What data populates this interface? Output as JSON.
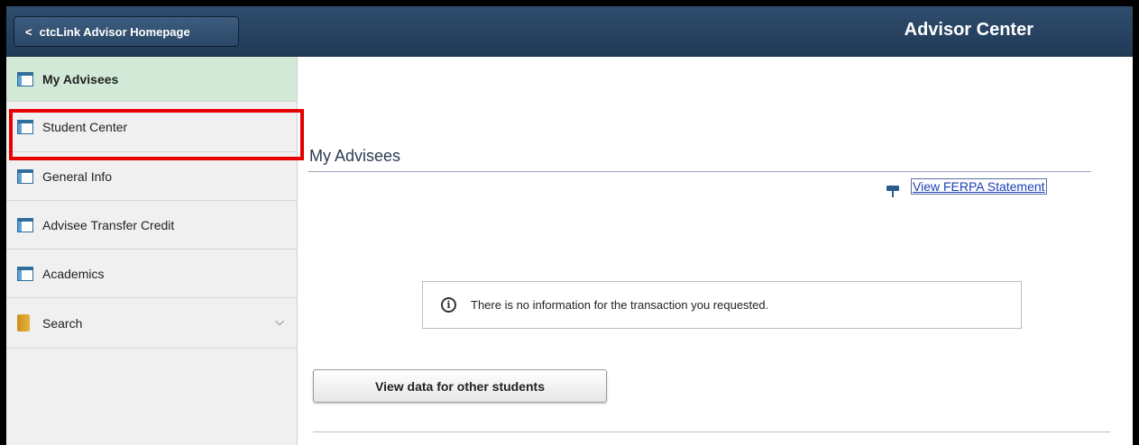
{
  "header": {
    "back_label": "ctcLink Advisor Homepage",
    "back_chevron": "<",
    "title": "Advisor Center"
  },
  "sidebar": {
    "items": [
      {
        "label": "My Advisees",
        "icon": "page-icon",
        "active": true
      },
      {
        "label": "Student Center",
        "icon": "page-icon",
        "highlighted": true
      },
      {
        "label": "General Info",
        "icon": "page-icon"
      },
      {
        "label": "Advisee Transfer Credit",
        "icon": "page-icon"
      },
      {
        "label": "Academics",
        "icon": "page-icon"
      },
      {
        "label": "Search",
        "icon": "folder-icon",
        "dropdown": "⌵"
      }
    ]
  },
  "main": {
    "section_title": "My Advisees",
    "ferpa_link": "View FERPA Statement",
    "info_symbol": "i",
    "message": "There is no information for the transaction you requested.",
    "other_students_button": "View data for other students"
  },
  "colors": {
    "banner": "#203a57",
    "active_item": "#d1e9d6",
    "highlight_box": "#e60000",
    "link": "#1a3fb5"
  }
}
